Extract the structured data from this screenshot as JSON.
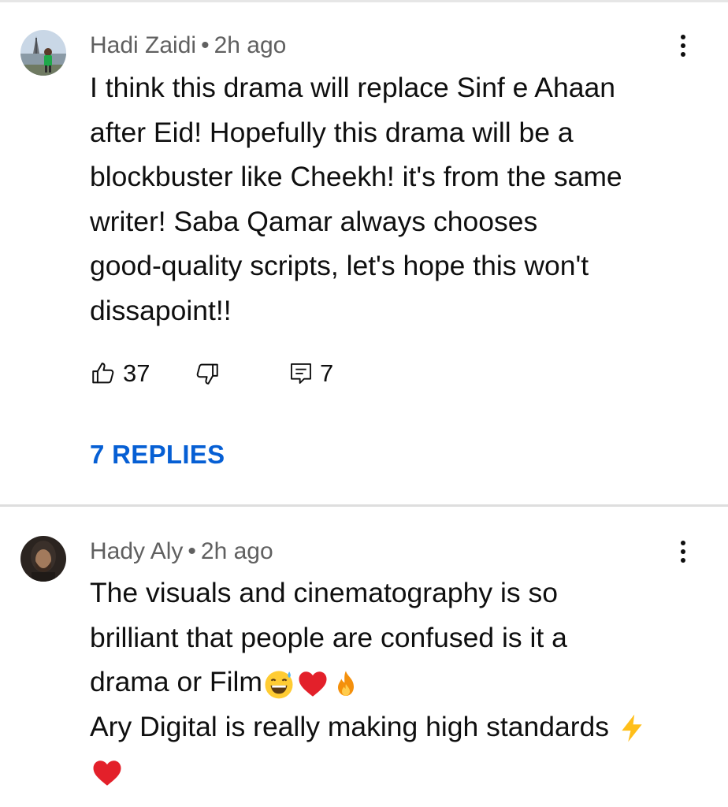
{
  "comments": [
    {
      "author": "Hadi Zaidi",
      "separator": "•",
      "time": "2h ago",
      "lines": [
        "I think this drama will replace Sinf e Ahaan",
        "after Eid! Hopefully this drama will be a",
        "blockbuster like Cheekh! it's from the same",
        "writer! Saba Qamar always chooses",
        "good-quality scripts, let's hope this won't",
        "dissapoint!!"
      ],
      "likes": "37",
      "replies_count": "7",
      "replies_link": "7 REPLIES"
    },
    {
      "author": "Hady Aly",
      "separator": "•",
      "time": "2h ago",
      "lines": [
        "The visuals and cinematography is so",
        "brilliant that people are confused is it a",
        "drama or Film",
        "Ary Digital is really making high standards"
      ],
      "emojis": [
        "sweat-smile-emoji",
        "red-heart-emoji",
        "fire-emoji",
        "lightning-emoji",
        "red-heart-emoji"
      ]
    }
  ],
  "colors": {
    "meta": "#606060",
    "text": "#0f0f0f",
    "link": "#065fd4",
    "divider": "#dedede"
  },
  "icons": [
    "avatar",
    "kebab-menu-icon",
    "thumbs-up-icon",
    "thumbs-down-icon",
    "reply-icon"
  ]
}
